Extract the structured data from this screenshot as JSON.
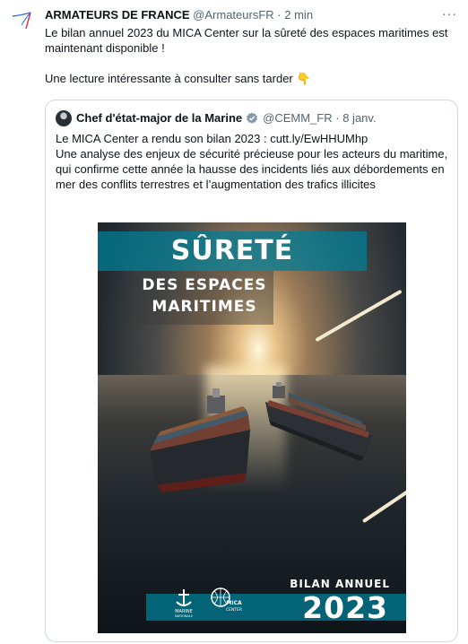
{
  "tweet": {
    "author": "ARMATEURS DE FRANCE",
    "handle": "@ArmateursFR",
    "separator": "·",
    "time": "2 min",
    "more_icon": "more-horizontal-icon",
    "text": "Le bilan annuel 2023 du MICA Center sur la sûreté des espaces maritimes est maintenant disponible !\n\nUne lecture intéressante à consulter sans tarder",
    "emoji": "👇"
  },
  "quote": {
    "author": "Chef d'état-major de la Marine",
    "handle": "@CEMM_FR",
    "separator": "·",
    "time": "8 janv.",
    "text": "Le MICA Center a rendu son bilan 2023 : cutt.ly/EwHHUMhp\nUne analyse des enjeux de sécurité précieuse pour les acteurs du maritime, qui confirme cette année la hausse des incidents liés aux débordements en mer des conflits terrestres et l’augmentation des trafics illicites",
    "verified_icon": "verified-badge-icon"
  },
  "poster": {
    "title": "SÛRETÉ",
    "subtitle": "DES ESPACES\nMARITIMES",
    "bilan_label": "BILAN ANNUEL",
    "year": "2023",
    "logo_left": "MARINE",
    "logo_left_sub": "NATIONALE",
    "logo_right": "MICA",
    "logo_right_sub": "CENTER"
  },
  "colors": {
    "accent_teal": "#007d96",
    "text_primary": "#0f1419",
    "text_secondary": "#536471",
    "border": "#cfd9de"
  }
}
